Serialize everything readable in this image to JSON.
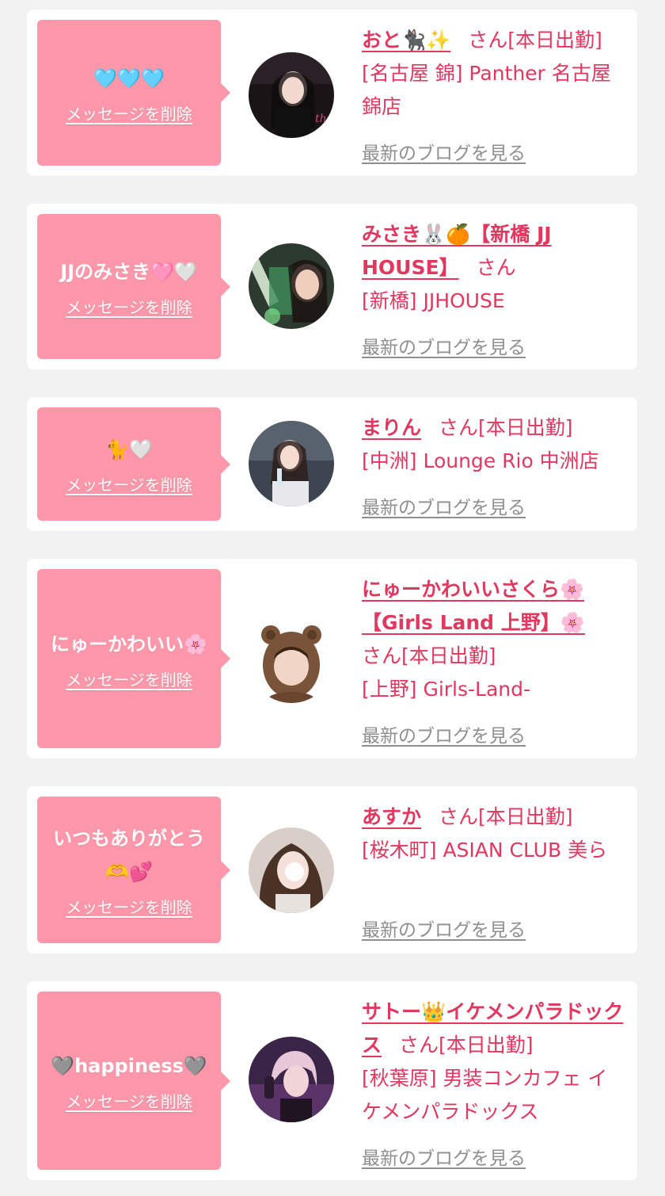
{
  "cards": [
    {
      "message": "🩵🩵🩵",
      "delete_label": "メッセージを削除",
      "name": "おと🐈‍⬛✨",
      "san": "さん",
      "status": "[本日出勤]",
      "location": "[名古屋 錦] Panther 名古屋錦店",
      "blog_link": "最新のブログを見る"
    },
    {
      "message": "JJのみさき🩷🤍",
      "delete_label": "メッセージを削除",
      "name": "みさき🐰🍊【新橋 JJ HOUSE】",
      "san": "さん",
      "status": "",
      "location": "[新橋] JJHOUSE",
      "blog_link": "最新のブログを見る"
    },
    {
      "message": "🐈🤍",
      "delete_label": "メッセージを削除",
      "name": "まりん",
      "san": "さん",
      "status": "[本日出勤]",
      "location": "[中洲] Lounge Rio 中洲店",
      "blog_link": "最新のブログを見る"
    },
    {
      "message": "にゅーかわいい🌸",
      "delete_label": "メッセージを削除",
      "name": "にゅーかわいいさくら🌸【Girls Land 上野】🌸",
      "san": "さん",
      "status": "[本日出勤]",
      "location": "[上野] Girls-Land-",
      "blog_link": "最新のブログを見る"
    },
    {
      "message": "いつもありがとう🫶💕",
      "delete_label": "メッセージを削除",
      "name": "あすか",
      "san": "さん",
      "status": "[本日出勤]",
      "location": "[桜木町] ASIAN CLUB 美ら",
      "blog_link": "最新のブログを見る"
    },
    {
      "message": "🩶happiness🩶",
      "delete_label": "メッセージを削除",
      "name": "サトー👑イケメンパラドックス",
      "san": "さん",
      "status": "[本日出勤]",
      "location": "[秋葉原] 男装コンカフェ イケメンパラドックス",
      "blog_link": "最新のブログを見る"
    }
  ],
  "colors": {
    "page_background": "#f2f2f2",
    "card_background": "#ffffff",
    "bubble": "#ff97aa",
    "accent_text": "#e2375f",
    "muted_link": "#8f8f8f"
  }
}
